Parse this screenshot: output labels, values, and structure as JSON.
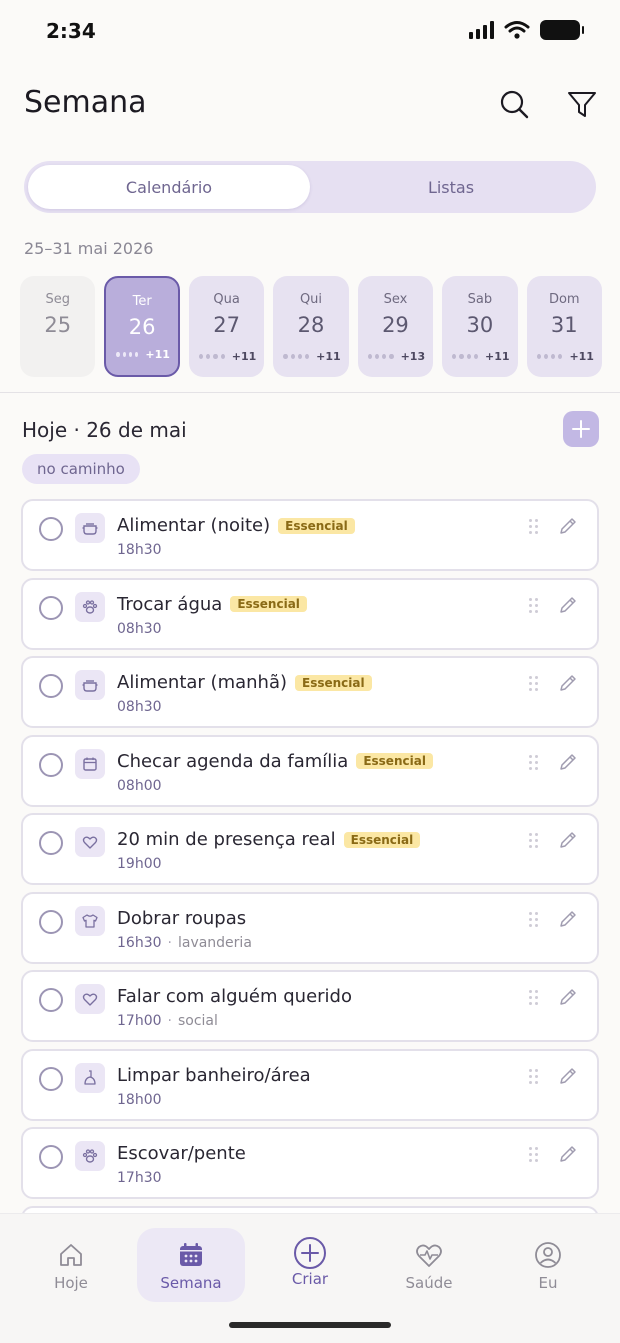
{
  "status": {
    "time": "2:34"
  },
  "header": {
    "title": "Semana"
  },
  "segmented": {
    "calendar": "Calendário",
    "lists": "Listas"
  },
  "week": {
    "range": "25–31 mai 2026",
    "days": [
      {
        "name": "Seg",
        "num": "25",
        "extra": ""
      },
      {
        "name": "Ter",
        "num": "26",
        "extra": "+11"
      },
      {
        "name": "Qua",
        "num": "27",
        "extra": "+11"
      },
      {
        "name": "Qui",
        "num": "28",
        "extra": "+11"
      },
      {
        "name": "Sex",
        "num": "29",
        "extra": "+13"
      },
      {
        "name": "Sab",
        "num": "30",
        "extra": "+11"
      },
      {
        "name": "Dom",
        "num": "31",
        "extra": "+11"
      }
    ]
  },
  "today": {
    "title": "Hoje · 26 de mai",
    "status": "no caminho"
  },
  "tasks": [
    {
      "title": "Alimentar (noite)",
      "badge": "Essencial",
      "time": "18h30",
      "category": "",
      "icon": "bowl-icon"
    },
    {
      "title": "Trocar água",
      "badge": "Essencial",
      "time": "08h30",
      "category": "",
      "icon": "paw-icon"
    },
    {
      "title": "Alimentar (manhã)",
      "badge": "Essencial",
      "time": "08h30",
      "category": "",
      "icon": "bowl-icon"
    },
    {
      "title": "Checar agenda da família",
      "badge": "Essencial",
      "time": "08h00",
      "category": "",
      "icon": "calendar-icon"
    },
    {
      "title": "20 min de presença real",
      "badge": "Essencial",
      "time": "19h00",
      "category": "",
      "icon": "heart-icon"
    },
    {
      "title": "Dobrar roupas",
      "badge": "",
      "time": "16h30",
      "category": "lavanderia",
      "icon": "shirt-icon"
    },
    {
      "title": "Falar com alguém querido",
      "badge": "",
      "time": "17h00",
      "category": "social",
      "icon": "heart-icon"
    },
    {
      "title": "Limpar banheiro/área",
      "badge": "",
      "time": "18h00",
      "category": "",
      "icon": "brush-icon"
    },
    {
      "title": "Escovar/pente",
      "badge": "",
      "time": "17h30",
      "category": "",
      "icon": "paw-icon"
    }
  ],
  "tabbar": {
    "home": "Hoje",
    "week": "Semana",
    "create": "Criar",
    "health": "Saúde",
    "me": "Eu"
  },
  "colors": {
    "accent": "#6a5aa8",
    "accent_light": "#e7e2f1",
    "badge_bg": "#fbe7a4"
  }
}
